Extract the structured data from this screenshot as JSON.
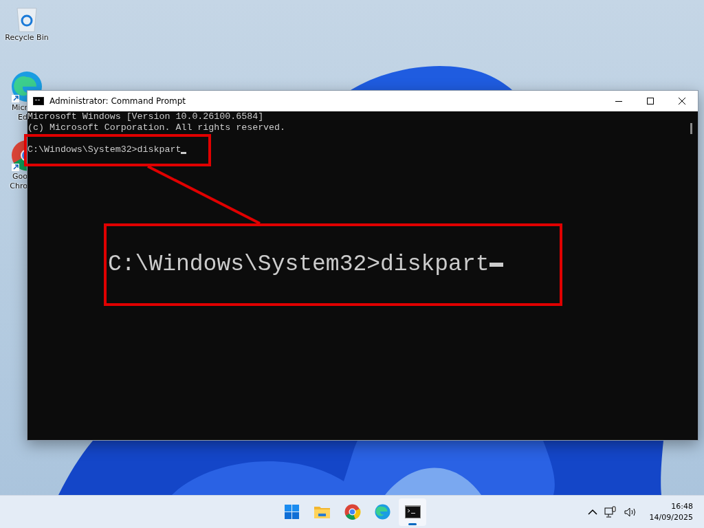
{
  "desktop_icons": [
    {
      "kind": "recycle",
      "lines": [
        "Recycle Bin"
      ]
    },
    {
      "kind": "edge",
      "lines": [
        "Micr",
        "Ed"
      ]
    },
    {
      "kind": "chrome",
      "lines": [
        "Goo",
        "Chro"
      ]
    }
  ],
  "window": {
    "title": "Administrator: Command Prompt",
    "output": [
      "Microsoft Windows [Version 10.0.26100.6584]",
      "(c) Microsoft Corporation. All rights reserved."
    ],
    "prompt": "C:\\Windows\\System32>diskpart"
  },
  "callout": {
    "text": "C:\\Windows\\System32>diskpart"
  },
  "taskbar": {
    "apps": [
      {
        "kind": "start",
        "selected": false
      },
      {
        "kind": "explorer",
        "selected": false
      },
      {
        "kind": "chrome",
        "selected": false
      },
      {
        "kind": "edge",
        "selected": false
      },
      {
        "kind": "terminal",
        "selected": true
      }
    ],
    "time": "16:48",
    "date": "14/09/2025"
  }
}
